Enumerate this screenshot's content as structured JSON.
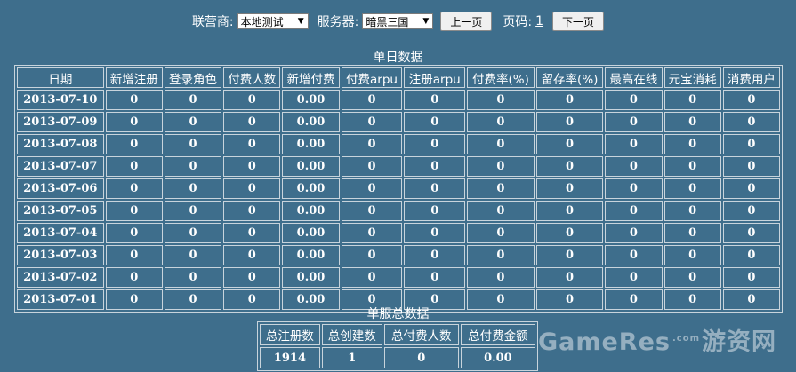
{
  "toolbar": {
    "operator_label": "联营商:",
    "operator_value": "本地测试",
    "server_label": "服务器:",
    "server_value": "暗黑三国",
    "prev_label": "上一页",
    "page_label": "页码:",
    "page_number": "1",
    "next_label": "下一页"
  },
  "daily": {
    "title": "单日数据",
    "columns": [
      "日期",
      "新增注册",
      "登录角色",
      "付费人数",
      "新增付费",
      "付费arpu",
      "注册arpu",
      "付费率(%)",
      "留存率(%)",
      "最高在线",
      "元宝消耗",
      "消费用户"
    ],
    "rows": [
      [
        "2013-07-10",
        "0",
        "0",
        "0",
        "0.00",
        "0",
        "0",
        "0",
        "0",
        "0",
        "0",
        "0"
      ],
      [
        "2013-07-09",
        "0",
        "0",
        "0",
        "0.00",
        "0",
        "0",
        "0",
        "0",
        "0",
        "0",
        "0"
      ],
      [
        "2013-07-08",
        "0",
        "0",
        "0",
        "0.00",
        "0",
        "0",
        "0",
        "0",
        "0",
        "0",
        "0"
      ],
      [
        "2013-07-07",
        "0",
        "0",
        "0",
        "0.00",
        "0",
        "0",
        "0",
        "0",
        "0",
        "0",
        "0"
      ],
      [
        "2013-07-06",
        "0",
        "0",
        "0",
        "0.00",
        "0",
        "0",
        "0",
        "0",
        "0",
        "0",
        "0"
      ],
      [
        "2013-07-05",
        "0",
        "0",
        "0",
        "0.00",
        "0",
        "0",
        "0",
        "0",
        "0",
        "0",
        "0"
      ],
      [
        "2013-07-04",
        "0",
        "0",
        "0",
        "0.00",
        "0",
        "0",
        "0",
        "0",
        "0",
        "0",
        "0"
      ],
      [
        "2013-07-03",
        "0",
        "0",
        "0",
        "0.00",
        "0",
        "0",
        "0",
        "0",
        "0",
        "0",
        "0"
      ],
      [
        "2013-07-02",
        "0",
        "0",
        "0",
        "0.00",
        "0",
        "0",
        "0",
        "0",
        "0",
        "0",
        "0"
      ],
      [
        "2013-07-01",
        "0",
        "0",
        "0",
        "0.00",
        "0",
        "0",
        "0",
        "0",
        "0",
        "0",
        "0"
      ]
    ]
  },
  "summary": {
    "title": "单服总数据",
    "columns": [
      "总注册数",
      "总创建数",
      "总付费人数",
      "总付费金额"
    ],
    "rows": [
      [
        "1914",
        "1",
        "0",
        "0.00"
      ]
    ]
  },
  "watermark": {
    "text_en": "GameRes",
    "text_com": ".com",
    "text_cn": "游资网"
  }
}
